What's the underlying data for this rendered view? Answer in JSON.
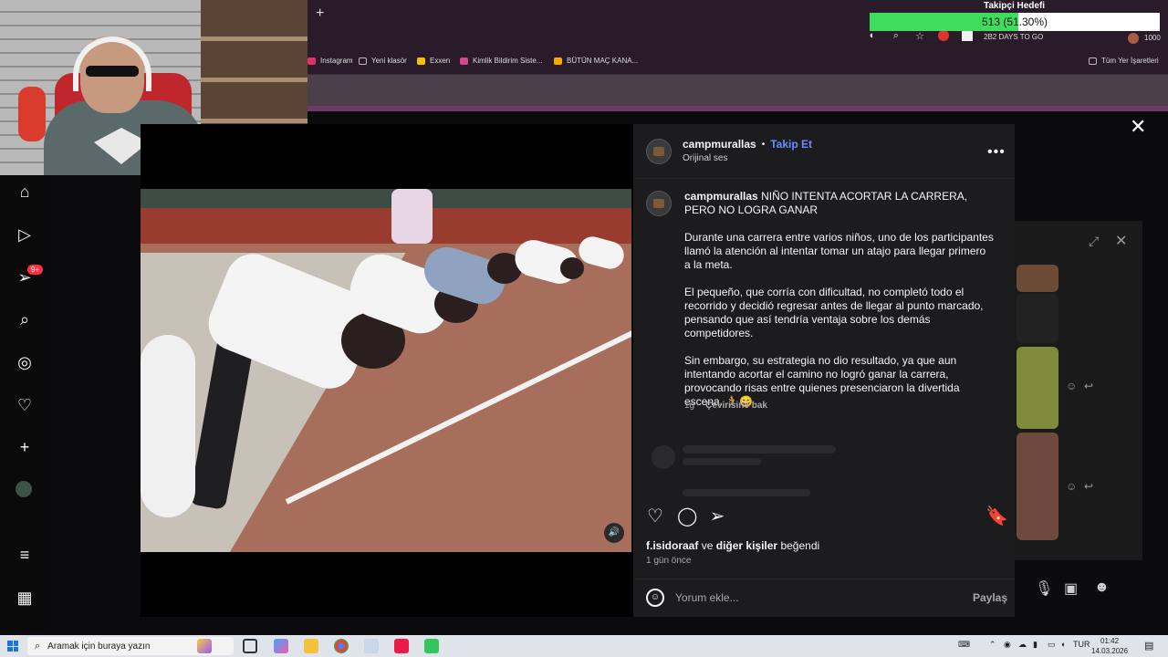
{
  "goal": {
    "title": "Takipçi Hedefi",
    "progress_text": "513 (51.30%)",
    "progress": 0.513
  },
  "browser": {
    "days_text": "2B2 DAYS TO GO",
    "count_text": "1000",
    "bookmarks": [
      {
        "label": "Instagram",
        "color": "#e1306c"
      },
      {
        "label": "Yeni klasör",
        "color": "#bbbbbb"
      },
      {
        "label": "Exxen",
        "color": "#f2c500"
      },
      {
        "label": "Kimlik Bildirim Siste...",
        "color": "#d04a8a"
      },
      {
        "label": "BÜTÜN MAÇ KANA...",
        "color": "#f2a900"
      }
    ],
    "all_bookmarks": "Tüm Yer İşaretleri"
  },
  "rail": {
    "notifications_badge": "9+"
  },
  "post": {
    "username": "campmurallas",
    "follow_label": "Takip Et",
    "audio": "Orijinal ses",
    "caption_title": "NIÑO INTENTA ACORTAR LA CARRERA, PERO NO LOGRA GANAR",
    "paragraphs": [
      "Durante una carrera entre varios niños, uno de los participantes llamó la atención al intentar tomar un atajo para llegar primero a la meta.",
      "El pequeño, que corría con dificultad, no completó todo el recorrido y decidió regresar antes de llegar al punto marcado, pensando que así tendría ventaja sobre los demás competidores.",
      "Sin embargo, su estrategia no dio resultado, ya que aun intentando acortar el camino no logró ganar la carrera, provocando risas entre quienes presenciaron la divertida escena. 🏃😄"
    ],
    "age": "1g",
    "translate": "Çevirisine bak",
    "liked_by_user": "f.isidoraaf",
    "liked_by_rest": "ve",
    "liked_by_others": "diğer kişiler",
    "liked_suffix": "beğendi",
    "time_ago": "1 gün önce",
    "comment_placeholder": "Yorum ekle...",
    "share_label": "Paylaş"
  },
  "taskbar": {
    "search_placeholder": "Aramak için buraya yazın",
    "lang": "TUR",
    "time": "01:42",
    "date": "14.03.2026"
  }
}
